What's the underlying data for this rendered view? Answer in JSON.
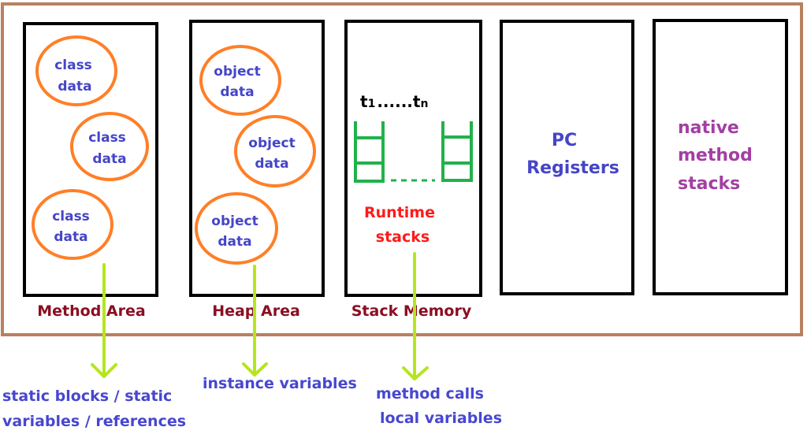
{
  "colors": {
    "frame": "#b9805f",
    "box": "#000000",
    "ellipse": "#ff7f27",
    "stack": "#22b14c",
    "arrow": "#b5e61d",
    "blue": "#4545c8",
    "area_label": "#8a0e22",
    "runtime": "#ff1a1a",
    "native": "#a33fa3"
  },
  "method_area": {
    "label": "Method Area",
    "items": [
      [
        "class",
        "data"
      ],
      [
        "class",
        "data"
      ],
      [
        "class",
        "data"
      ]
    ],
    "note": [
      "static blocks / static",
      "variables / references"
    ]
  },
  "heap_area": {
    "label": "Heap Area",
    "items": [
      [
        "object",
        "data"
      ],
      [
        "object",
        "data"
      ],
      [
        "object",
        "data"
      ]
    ],
    "note": "instance variables"
  },
  "stack_memory": {
    "label": "Stack Memory",
    "thread_first": "t",
    "thread_first_sub": "1",
    "dots": "......",
    "thread_last": "t",
    "thread_last_sub": "n",
    "runtime": [
      "Runtime",
      "stacks"
    ],
    "note": [
      "method calls",
      "local variables"
    ]
  },
  "pc_registers": {
    "lines": [
      "PC",
      "Registers"
    ]
  },
  "native_stacks": {
    "lines": [
      "native",
      "method",
      "stacks"
    ]
  }
}
